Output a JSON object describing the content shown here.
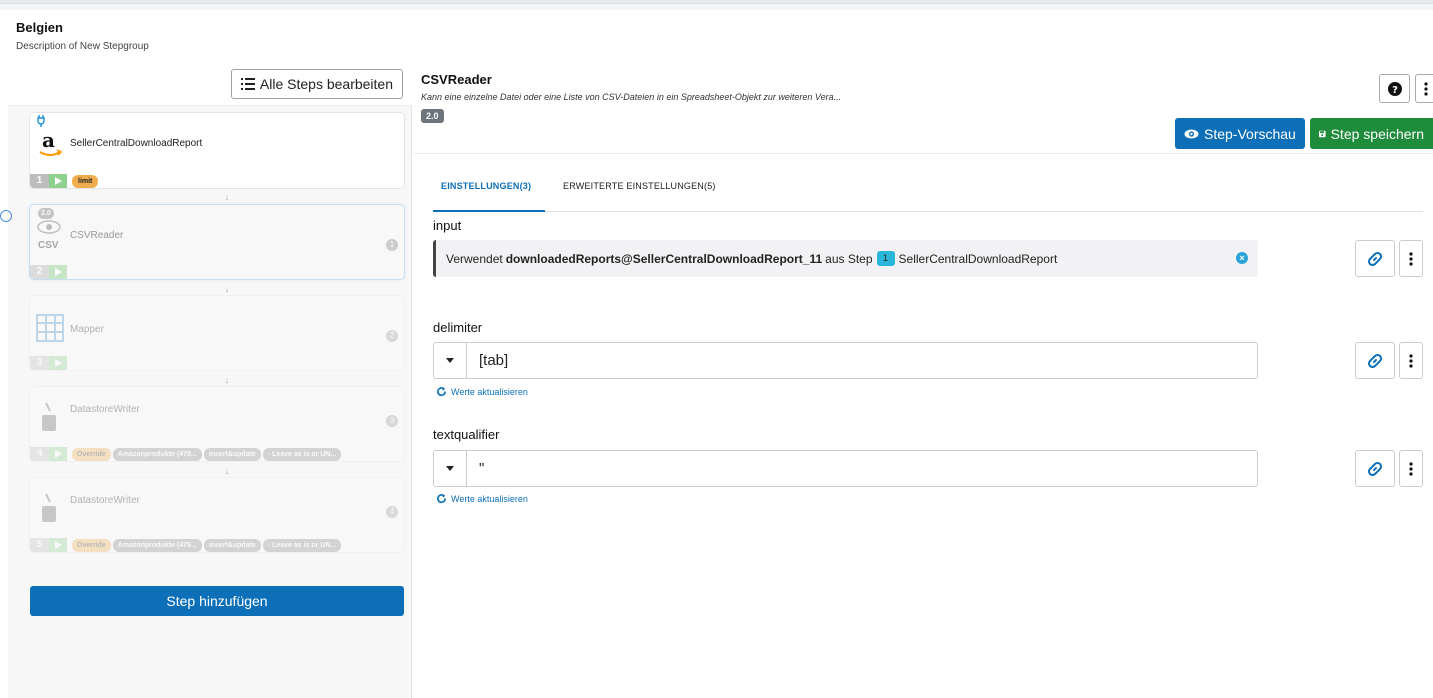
{
  "group": {
    "title": "Belgien",
    "description": "Description of New Stepgroup"
  },
  "left": {
    "edit_all_label": "Alle Steps bearbeiten",
    "add_step_label": "Step hinzufügen",
    "steps": [
      {
        "num": "1",
        "name": "SellerCentralDownloadReport",
        "badge": "limit"
      },
      {
        "num": "2",
        "name": "CSVReader",
        "version": "2.0",
        "icon_text": "CSV",
        "right_num": "1"
      },
      {
        "num": "3",
        "name": "Mapper",
        "right_num": "2"
      },
      {
        "num": "4",
        "name": "DatastoreWriter",
        "right_num": "3",
        "chips": [
          "Override",
          "Amazonprodukte (479...",
          "insert&update",
          "- Leave as is or UN..."
        ]
      },
      {
        "num": "5",
        "name": "DatastoreWriter",
        "right_num": "4",
        "chips": [
          "Override",
          "Amazonprodukte (479...",
          "insert&update",
          "- Leave as is or UN..."
        ]
      }
    ]
  },
  "right": {
    "title": "CSVReader",
    "description": "Kann eine einzelne Datei oder eine Liste von CSV-Dateien in ein Spreadsheet-Objekt zur weiteren Vera...",
    "version": "2.0",
    "preview_label": "Step-Vorschau",
    "save_label": "Step speichern",
    "tabs": [
      "EINSTELLUNGEN(3)",
      "ERWEITERTE EINSTELLUNGEN(5)"
    ],
    "fields": {
      "input": {
        "label": "input",
        "prefix": "Verwendet",
        "ref": "downloadedReports@SellerCentralDownloadReport_11",
        "middle": "aus Step",
        "step_num": "1",
        "step_name": "SellerCentralDownloadReport"
      },
      "delimiter": {
        "label": "delimiter",
        "value": "[tab]",
        "refresh": "Werte aktualisieren"
      },
      "textqualifier": {
        "label": "textqualifier",
        "value": "\"",
        "refresh": "Werte aktualisieren"
      }
    }
  },
  "colors": {
    "primary": "#0d6fb8",
    "success": "#1e8c3a",
    "warning": "#f0ad4e",
    "info": "#29b6d8"
  }
}
